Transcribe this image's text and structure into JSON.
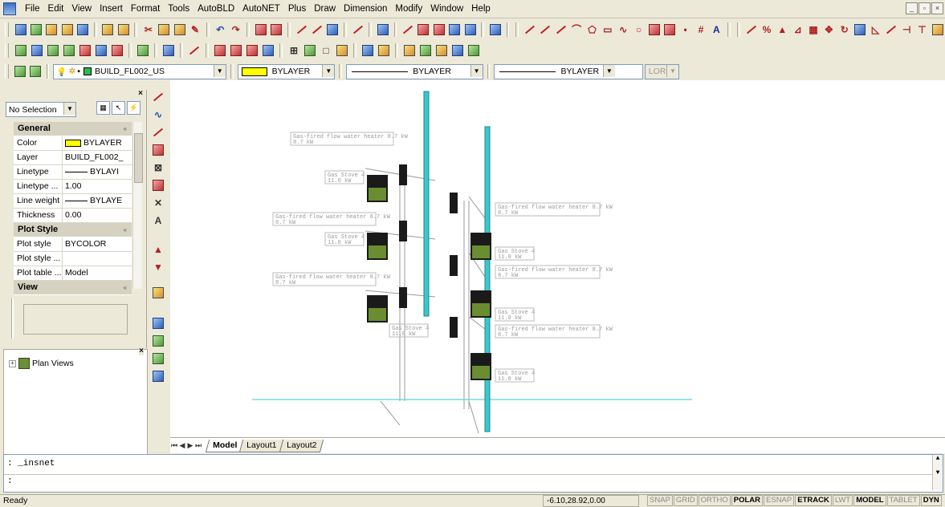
{
  "menubar": {
    "items": [
      "File",
      "Edit",
      "View",
      "Insert",
      "Format",
      "Tools",
      "AutoBLD",
      "AutoNET",
      "Plus",
      "Draw",
      "Dimension",
      "Modify",
      "Window",
      "Help"
    ]
  },
  "layerbar": {
    "layer_name": "BUILD_FL002_US",
    "color": "BYLAYER",
    "linetype": "BYLAYER",
    "lineweight": "BYLAYER",
    "plotstyle": "LOR"
  },
  "properties": {
    "selection": "No Selection",
    "general": {
      "title": "General",
      "rows": [
        {
          "key": "Color",
          "value": "BYLAYER"
        },
        {
          "key": "Layer",
          "value": "BUILD_FL002_"
        },
        {
          "key": "Linetype",
          "value": "BYLAYI"
        },
        {
          "key": "Linetype ...",
          "value": "1.00"
        },
        {
          "key": "Line weight",
          "value": "BYLAYE"
        },
        {
          "key": "Thickness",
          "value": "0.00"
        }
      ]
    },
    "plot_style": {
      "title": "Plot Style",
      "rows": [
        {
          "key": "Plot style",
          "value": "BYCOLOR"
        },
        {
          "key": "Plot style ...",
          "value": ""
        },
        {
          "key": "Plot table ...",
          "value": "Model"
        }
      ]
    },
    "view": {
      "title": "View"
    }
  },
  "tree": {
    "root": "Plan Views"
  },
  "drawing": {
    "labels": [
      "Gas-fired flow water heater 8.7 kW\n8.7 kW",
      "Gas Stove 4\n11.0 kW",
      "Gas-fired flow water heater 8.7 kW\n8.7 kW",
      "Gas Stove 4\n11.0 kW",
      "Gas-fired flow water heater 8.7 kW\n8.7 kW",
      "Gas Stove 4\n11.0 kW",
      "Gas-fired flow water heater 8.7 kW\n8.7 kW",
      "Gas Stove 4\n11.0 kW",
      "Gas-fired flow water heater 8.7 kW\n8.7 kW",
      "Gas Stove 4\n11.0 kW",
      "Gas-fired flow water heater 8.7 kW\n8.7 kW",
      "Gas Stove 4\n11.0 kW"
    ]
  },
  "layout_tabs": [
    "Model",
    "Layout1",
    "Layout2"
  ],
  "command": {
    "line1": ": _insnet",
    "line2": ":"
  },
  "status": {
    "ready": "Ready",
    "coords": "-6.10,28.92,0.00",
    "toggles": [
      {
        "label": "SNAP",
        "on": false
      },
      {
        "label": "GRID",
        "on": false
      },
      {
        "label": "ORTHO",
        "on": false
      },
      {
        "label": "POLAR",
        "on": true
      },
      {
        "label": "ESNAP",
        "on": false
      },
      {
        "label": "ETRACK",
        "on": true
      },
      {
        "label": "LWT",
        "on": false
      },
      {
        "label": "MODEL",
        "on": true
      },
      {
        "label": "TABLET",
        "on": false
      },
      {
        "label": "DYN",
        "on": true
      }
    ]
  }
}
